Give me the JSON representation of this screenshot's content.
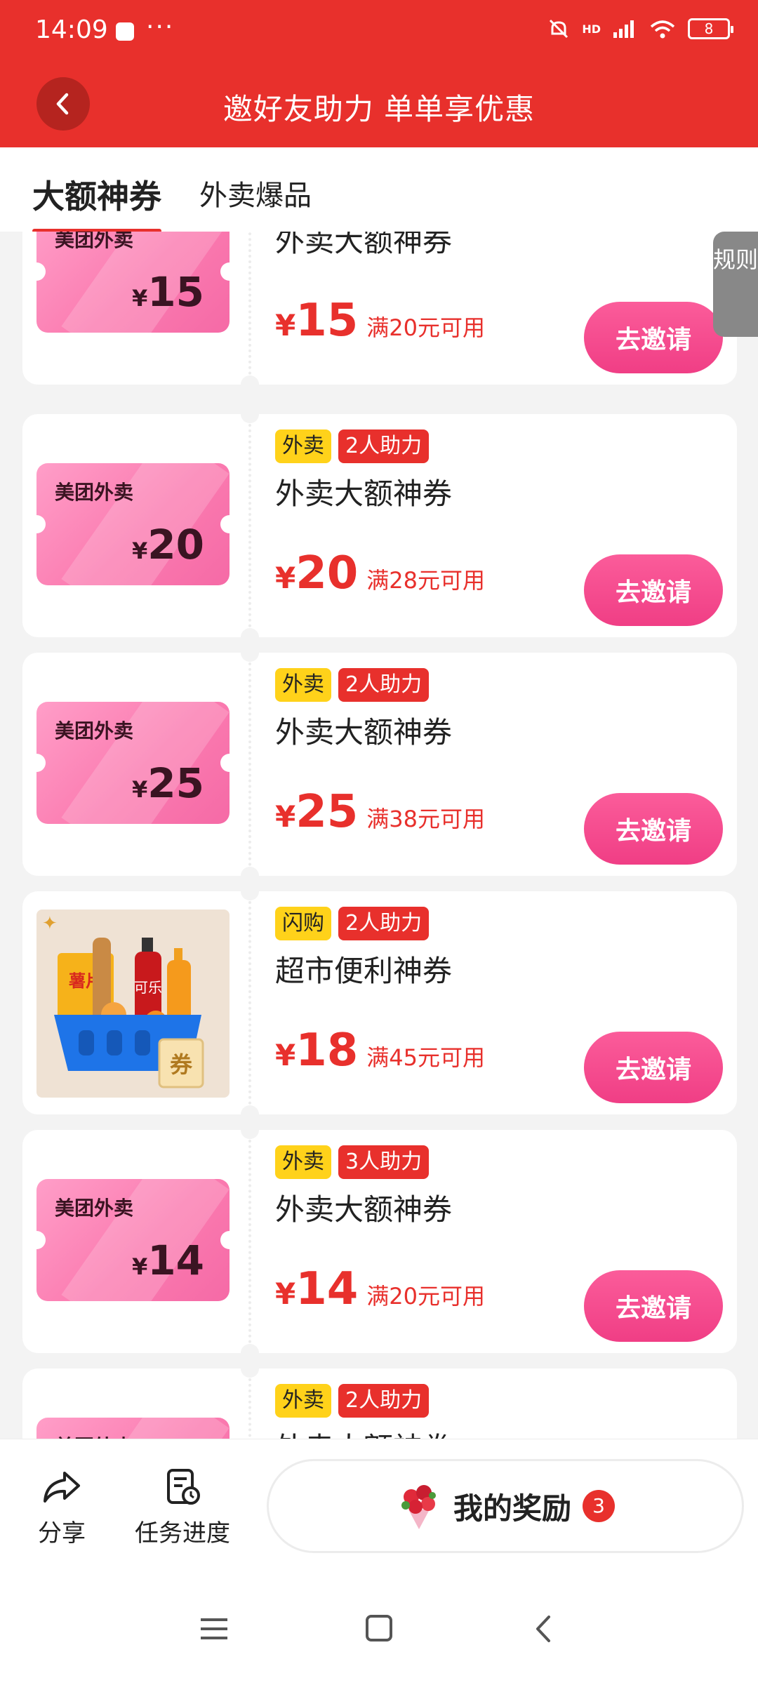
{
  "status_bar": {
    "time": "14:09",
    "more": "···",
    "network": "HD",
    "battery": "8"
  },
  "header": {
    "title": "邀好友助力 单单享优惠"
  },
  "tabs": [
    {
      "label": "大额神券",
      "active": true
    },
    {
      "label": "外卖爆品",
      "active": false
    }
  ],
  "side_rules": {
    "label": "规则"
  },
  "cards": [
    {
      "type": "ticket",
      "brand": "美团外卖",
      "currency": "¥",
      "face": "15",
      "tags": [],
      "name": "外卖大额神券",
      "price": "15",
      "condition": "满20元可用",
      "button": "去邀请"
    },
    {
      "type": "ticket",
      "brand": "美团外卖",
      "currency": "¥",
      "face": "20",
      "tags": [
        {
          "label": "外卖",
          "kind": "cat"
        },
        {
          "label": "2人助力",
          "kind": "help"
        }
      ],
      "name": "外卖大额神券",
      "price": "20",
      "condition": "满28元可用",
      "button": "去邀请"
    },
    {
      "type": "ticket",
      "brand": "美团外卖",
      "currency": "¥",
      "face": "25",
      "tags": [
        {
          "label": "外卖",
          "kind": "cat"
        },
        {
          "label": "2人助力",
          "kind": "help"
        }
      ],
      "name": "外卖大额神券",
      "price": "25",
      "condition": "满38元可用",
      "button": "去邀请"
    },
    {
      "type": "product",
      "product_labels": {
        "chips": "薯片",
        "cola": "可乐",
        "coupon": "券"
      },
      "tags": [
        {
          "label": "闪购",
          "kind": "cat"
        },
        {
          "label": "2人助力",
          "kind": "help"
        }
      ],
      "name": "超市便利神券",
      "price": "18",
      "condition": "满45元可用",
      "button": "去邀请"
    },
    {
      "type": "ticket",
      "brand": "美团外卖",
      "currency": "¥",
      "face": "14",
      "tags": [
        {
          "label": "外卖",
          "kind": "cat"
        },
        {
          "label": "3人助力",
          "kind": "help"
        }
      ],
      "name": "外卖大额神券",
      "price": "14",
      "condition": "满20元可用",
      "button": "去邀请"
    },
    {
      "type": "ticket",
      "brand": "美团外卖",
      "currency": "¥",
      "face": "",
      "tags": [
        {
          "label": "外卖",
          "kind": "cat"
        },
        {
          "label": "2人助力",
          "kind": "help"
        }
      ],
      "name": "外卖大额神券",
      "price": "",
      "condition": "",
      "button": ""
    }
  ],
  "price_currency": "¥",
  "bottom_bar": {
    "share": {
      "label": "分享",
      "icon": "share-icon"
    },
    "progress": {
      "label": "任务进度",
      "icon": "task-progress-icon"
    },
    "reward": {
      "label": "我的奖励",
      "badge": "3",
      "icon": "flower-bouquet-icon"
    }
  },
  "colors": {
    "brand_red": "#e8302c",
    "invite_pink": "#f03e85",
    "tag_yellow": "#ffd21a",
    "ticket_pink": "#fb7bb0"
  },
  "system_nav": [
    "menu-icon",
    "home-icon",
    "back-icon"
  ]
}
